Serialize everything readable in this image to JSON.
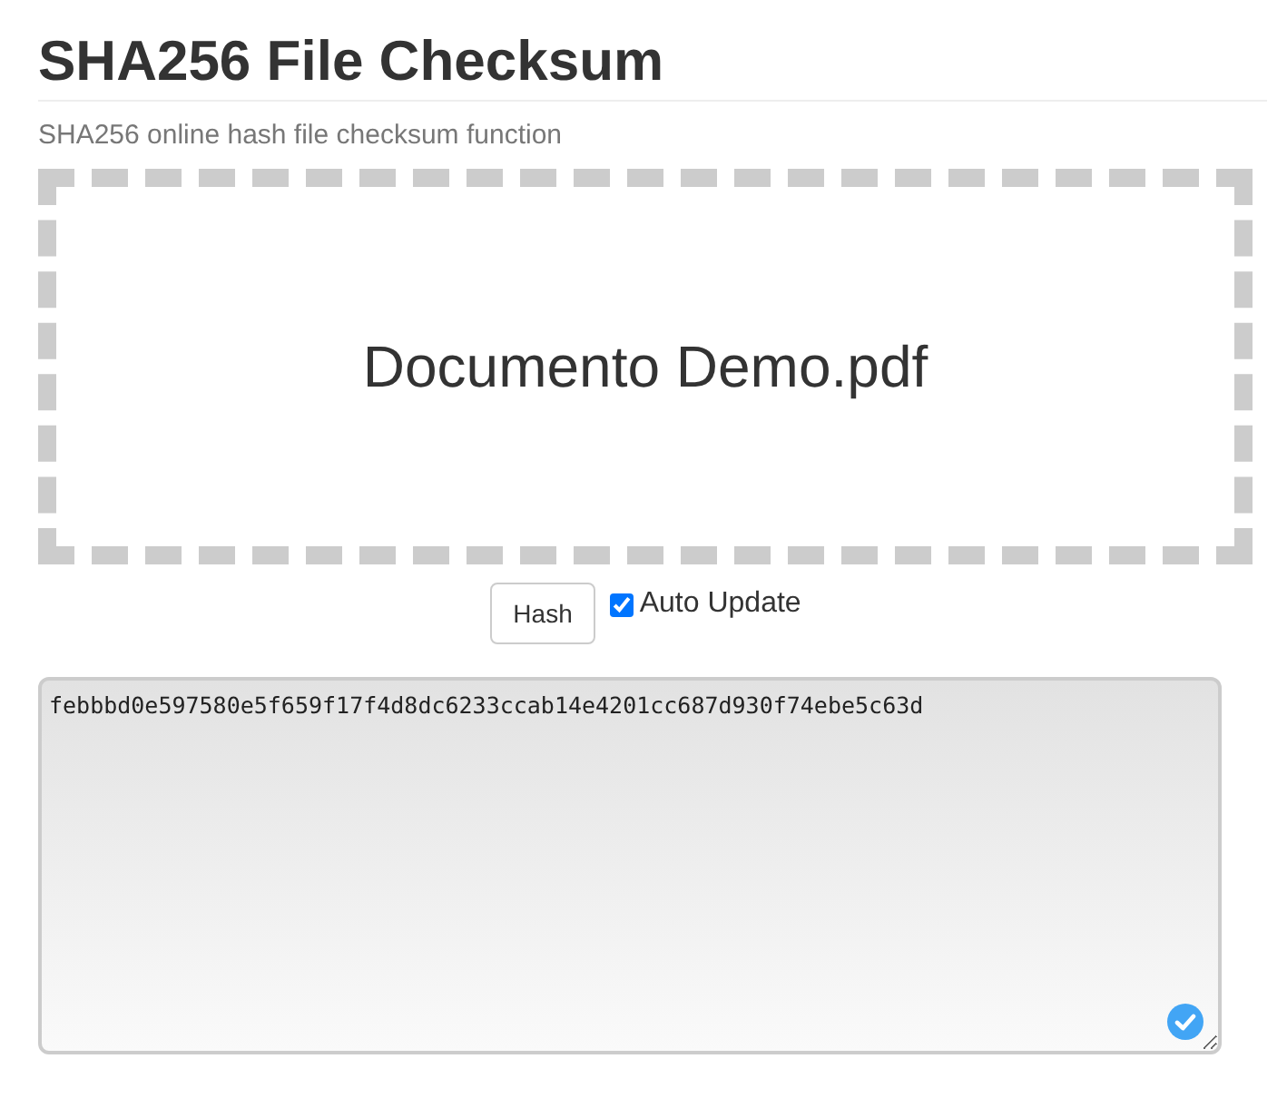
{
  "title": "SHA256 File Checksum",
  "subtitle": "SHA256 online hash file checksum function",
  "drop_zone": {
    "file_name": "Documento Demo.pdf"
  },
  "hash_button": "Hash",
  "auto_update": {
    "label": "Auto Update",
    "checked": true
  },
  "output": {
    "value": "febbbd0e597580e5f659f17f4d8dc6233ccab14e4201cc687d930f74ebe5c63d",
    "verified": true
  }
}
